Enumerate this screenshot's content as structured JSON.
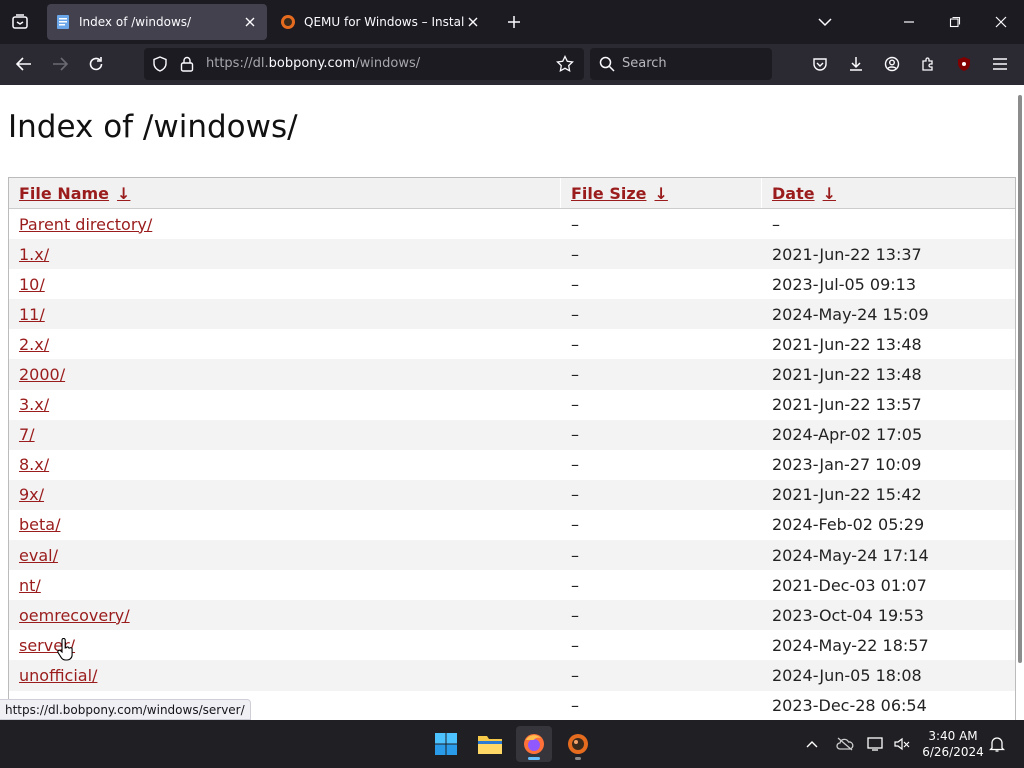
{
  "browser": {
    "tabs": [
      {
        "title": "Index of /windows/",
        "active": true
      },
      {
        "title": "QEMU for Windows – Installers",
        "active": false
      }
    ],
    "url_prefix": "https://dl.",
    "url_domain": "bobpony.com",
    "url_path": "/windows/",
    "search_placeholder": "Search"
  },
  "page": {
    "title": "Index of /windows/",
    "columns": {
      "name": "File Name",
      "size": "File Size",
      "date": "Date",
      "sort_arrow": "↓"
    },
    "rows": [
      {
        "name": "Parent directory/",
        "size": "–",
        "date": "–"
      },
      {
        "name": "1.x/",
        "size": "–",
        "date": "2021-Jun-22 13:37"
      },
      {
        "name": "10/",
        "size": "–",
        "date": "2023-Jul-05 09:13"
      },
      {
        "name": "11/",
        "size": "–",
        "date": "2024-May-24 15:09"
      },
      {
        "name": "2.x/",
        "size": "–",
        "date": "2021-Jun-22 13:48"
      },
      {
        "name": "2000/",
        "size": "–",
        "date": "2021-Jun-22 13:48"
      },
      {
        "name": "3.x/",
        "size": "–",
        "date": "2021-Jun-22 13:57"
      },
      {
        "name": "7/",
        "size": "–",
        "date": "2024-Apr-02 17:05"
      },
      {
        "name": "8.x/",
        "size": "–",
        "date": "2023-Jan-27 10:09"
      },
      {
        "name": "9x/",
        "size": "–",
        "date": "2021-Jun-22 15:42"
      },
      {
        "name": "beta/",
        "size": "–",
        "date": "2024-Feb-02 05:29"
      },
      {
        "name": "eval/",
        "size": "–",
        "date": "2024-May-24 17:14"
      },
      {
        "name": "nt/",
        "size": "–",
        "date": "2021-Dec-03 01:07"
      },
      {
        "name": "oemrecovery/",
        "size": "–",
        "date": "2023-Oct-04 19:53"
      },
      {
        "name": "server/",
        "size": "–",
        "date": "2024-May-22 18:57"
      },
      {
        "name": "unofficial/",
        "size": "–",
        "date": "2024-Jun-05 18:08"
      },
      {
        "name": "",
        "size": "–",
        "date": "2023-Dec-28 06:54"
      }
    ],
    "status_url": "https://dl.bobpony.com/windows/server/"
  },
  "taskbar": {
    "time": "3:40 AM",
    "date": "6/26/2024"
  },
  "colors": {
    "link": "#9a1c1c",
    "accent": "#66c0ff"
  }
}
